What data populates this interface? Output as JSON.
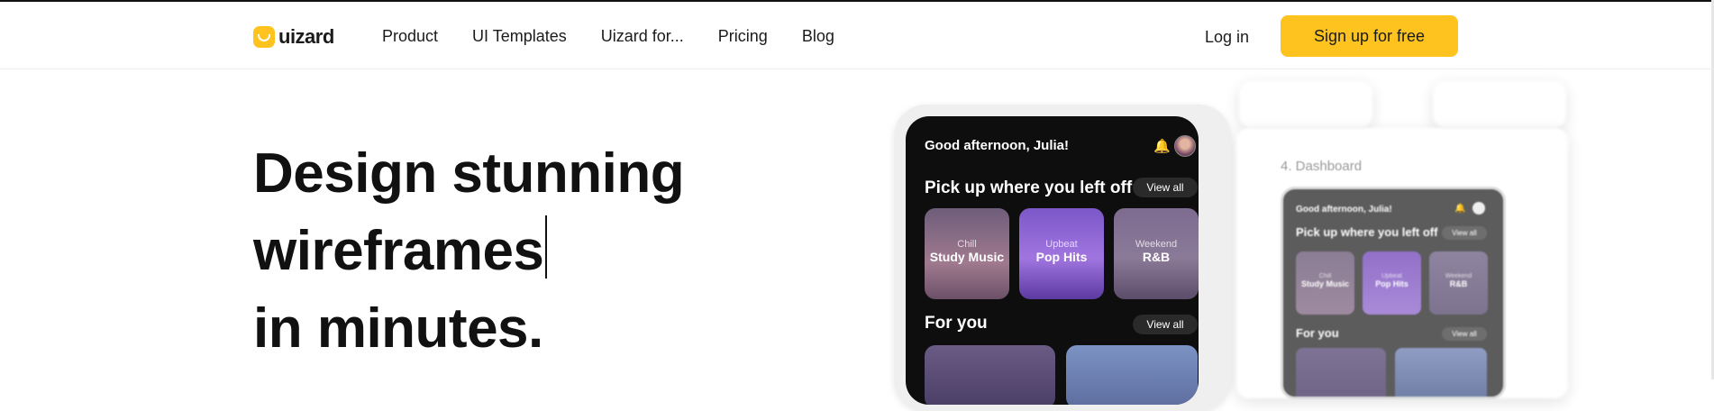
{
  "nav": {
    "logo_text": "uizard",
    "links": [
      "Product",
      "UI Templates",
      "Uizard for...",
      "Pricing",
      "Blog"
    ],
    "login_label": "Log in",
    "signup_label": "Sign up for free"
  },
  "hero": {
    "line1": "Design stunning",
    "line2": "wireframes",
    "line3": "in minutes."
  },
  "mockup_main": {
    "greeting": "Good afternoon, Julia!",
    "section1_title": "Pick up where you left off",
    "section2_title": "For you",
    "view_all": "View all",
    "cards": [
      {
        "sub": "Chill",
        "main": "Study Music"
      },
      {
        "sub": "Upbeat",
        "main": "Pop Hits"
      },
      {
        "sub": "Weekend",
        "main": "R&B"
      }
    ]
  },
  "mockup_secondary": {
    "label": "4. Dashboard",
    "greeting": "Good afternoon, Julia!",
    "section1_title": "Pick up where you left off",
    "section2_title": "For you",
    "view_all": "View all",
    "cards": [
      {
        "sub": "Chill",
        "main": "Study Music"
      },
      {
        "sub": "Upbeat",
        "main": "Pop Hits"
      },
      {
        "sub": "Weekend",
        "main": "R&B"
      }
    ]
  },
  "colors": {
    "brand_yellow": "#ffc31f",
    "text_dark": "#111111",
    "phone_dark": "#0e0e0e"
  },
  "icons": {
    "logo": "uizard-logo-icon",
    "notification": "bell-icon",
    "avatar": "user-avatar"
  }
}
